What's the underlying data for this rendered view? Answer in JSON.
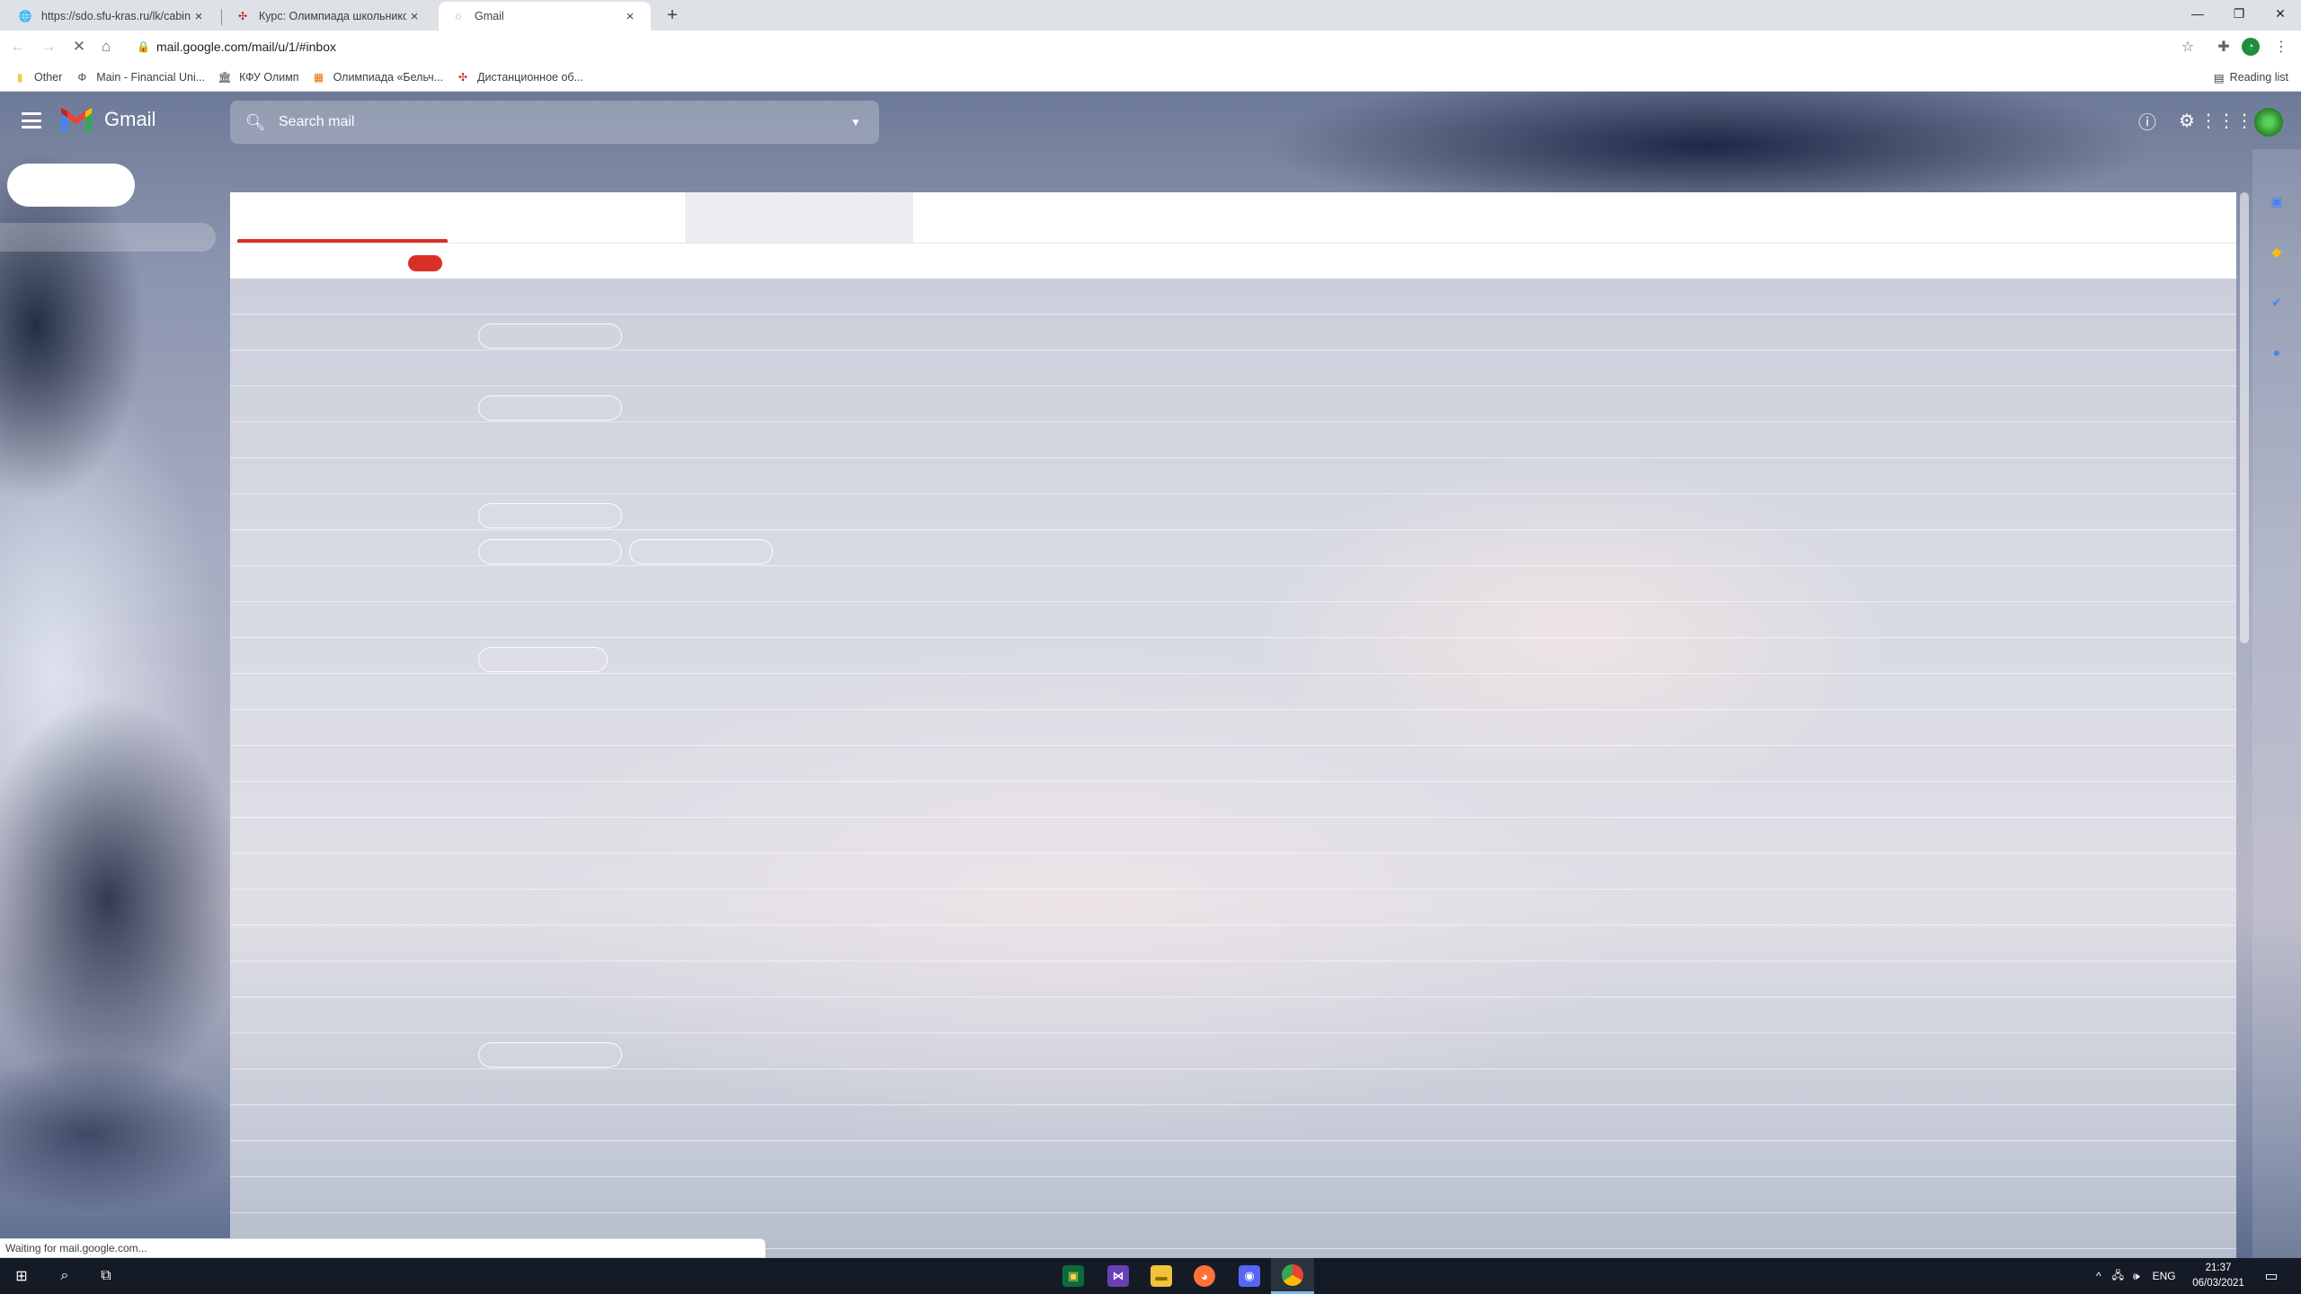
{
  "browser": {
    "tabs": [
      {
        "title": "https://sdo.sfu-kras.ru/lk/cabinet",
        "favicon": "globe-icon"
      },
      {
        "title": "Курс: Олимпиада школьников «",
        "favicon": "sfu-logo-icon"
      },
      {
        "title": "Gmail",
        "favicon": "gmail-icon",
        "active": true
      }
    ],
    "url": "mail.google.com/mail/u/1/#inbox",
    "bookmarks": [
      {
        "label": "Other",
        "icon": "folder-icon"
      },
      {
        "label": "Main - Financial Uni...",
        "icon": "fa-logo-icon"
      },
      {
        "label": "КФУ Олимп",
        "icon": "university-icon"
      },
      {
        "label": "Олимпиада «Бельч...",
        "icon": "olymp-logo-icon"
      },
      {
        "label": "Дистанционное об...",
        "icon": "sfu-logo-icon"
      }
    ],
    "reading_list": "Reading list",
    "status_text": "Waiting for mail.google.com..."
  },
  "gmail": {
    "app_name": "Gmail",
    "search_placeholder": "Search mail"
  },
  "taskbar": {
    "language": "ENG",
    "time": "21:37",
    "date": "06/03/2021"
  },
  "colors": {
    "accent_red": "#d93025",
    "taskbar": "#151b26"
  }
}
